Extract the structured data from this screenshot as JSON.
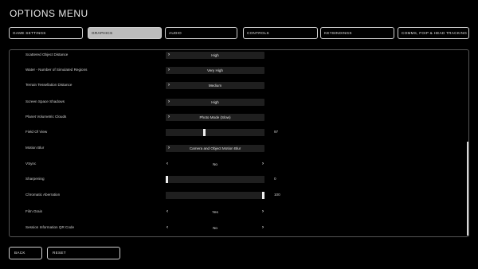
{
  "window": {
    "title": "OPTIONS MENU"
  },
  "tabs": [
    {
      "label": "GAME SETTINGS"
    },
    {
      "label": "GRAPHICS",
      "active": true
    },
    {
      "label": "AUDIO"
    },
    {
      "label": "CONTROLS"
    },
    {
      "label": "KEYBINDINGS"
    },
    {
      "label": "COMMS, FOIP & HEAD TRACKING"
    }
  ],
  "settings": [
    {
      "label": "Scattered Object Distance",
      "type": "select",
      "value": "High"
    },
    {
      "label": "Water - Number of Simulated Regions",
      "type": "select",
      "value": "Very High"
    },
    {
      "label": "Terrain Tessellation Distance",
      "type": "select",
      "value": "Medium"
    },
    {
      "label": "Screen Space Shadows",
      "type": "select",
      "value": "High"
    },
    {
      "label": "Planet Volumetric Clouds",
      "type": "select",
      "value": "Photo Mode (Slow)"
    },
    {
      "label": "Field Of View",
      "type": "slider",
      "value": "97",
      "fraction": 0.39
    },
    {
      "label": "Motion Blur",
      "type": "select",
      "value": "Camera and Object Motion Blur"
    },
    {
      "label": "VSync",
      "type": "toggle",
      "value": "No"
    },
    {
      "label": "Sharpening",
      "type": "slider",
      "value": "0",
      "fraction": 0.0
    },
    {
      "label": "Chromatic Aberration",
      "type": "slider",
      "value": "100",
      "fraction": 1.0
    },
    {
      "label": "Film Grain",
      "type": "toggle",
      "value": "Yes"
    },
    {
      "label": "Session Information QR Code",
      "type": "toggle",
      "value": "No"
    }
  ],
  "footer": {
    "back_label": "BACK",
    "reset_label": "RESET"
  },
  "colors": {
    "background": "#000000",
    "active_tab": "#bcbcbc",
    "control_bg": "#1f1f1f",
    "border": "#cfcfcf"
  },
  "icons": {
    "select_arrow": "chevron-right-icon",
    "prev": "chevron-left-icon",
    "next": "chevron-right-icon"
  }
}
